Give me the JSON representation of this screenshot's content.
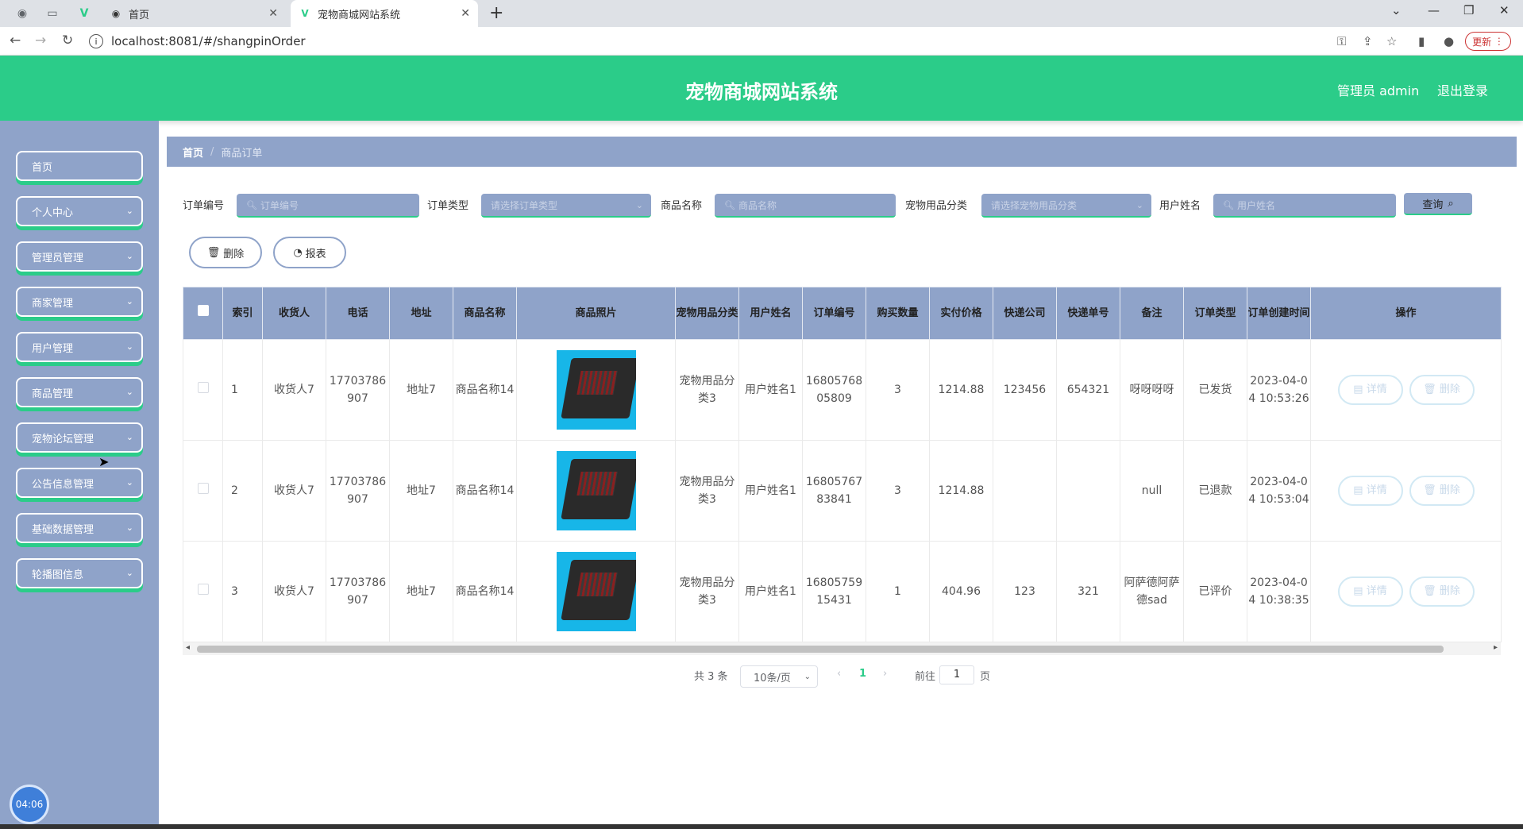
{
  "browser": {
    "tabs": [
      {
        "label": "首页",
        "active": false
      },
      {
        "label": "宠物商城网站系统",
        "active": true
      }
    ],
    "url": "localhost:8081/#/shangpinOrder",
    "update_label": "更新"
  },
  "header": {
    "title": "宠物商城网站系统",
    "admin": "管理员 admin",
    "logout": "退出登录"
  },
  "sidebar": {
    "items": [
      {
        "label": "首页"
      },
      {
        "label": "个人中心"
      },
      {
        "label": "管理员管理"
      },
      {
        "label": "商家管理"
      },
      {
        "label": "用户管理"
      },
      {
        "label": "商品管理"
      },
      {
        "label": "宠物论坛管理"
      },
      {
        "label": "公告信息管理"
      },
      {
        "label": "基础数据管理"
      },
      {
        "label": "轮播图信息"
      }
    ],
    "clock": "04:06"
  },
  "breadcrumb": {
    "home": "首页",
    "separator": "/",
    "current": "商品订单"
  },
  "search": {
    "fields": [
      {
        "label": "订单编号",
        "placeholder": "订单编号"
      },
      {
        "label": "订单类型",
        "placeholder": "请选择订单类型"
      },
      {
        "label": "商品名称",
        "placeholder": "商品名称"
      },
      {
        "label": "宠物用品分类",
        "placeholder": "请选择宠物用品分类"
      },
      {
        "label": "用户姓名",
        "placeholder": "用户姓名"
      }
    ],
    "query_label": "查询"
  },
  "actions": {
    "delete_label": "删除",
    "report_label": "报表"
  },
  "table": {
    "headers": [
      "索引",
      "收货人",
      "电话",
      "地址",
      "商品名称",
      "商品照片",
      "宠物用品分类",
      "用户姓名",
      "订单编号",
      "购买数量",
      "实付价格",
      "快递公司",
      "快递单号",
      "备注",
      "订单类型",
      "订单创建时间",
      "操作"
    ],
    "rows": [
      {
        "index": "1",
        "receiver": "收货人7",
        "phone": "17703786907",
        "address": "地址7",
        "product": "商品名称14",
        "category": "宠物用品分类3",
        "user": "用户姓名1",
        "order_no": "1680576805809",
        "qty": "3",
        "price": "1214.88",
        "courier": "123456",
        "tracking": "654321",
        "remark": "呀呀呀呀",
        "order_type": "已发货",
        "created": "2023-04-04 10:53:26"
      },
      {
        "index": "2",
        "receiver": "收货人7",
        "phone": "17703786907",
        "address": "地址7",
        "product": "商品名称14",
        "category": "宠物用品分类3",
        "user": "用户姓名1",
        "order_no": "1680576783841",
        "qty": "3",
        "price": "1214.88",
        "courier": "",
        "tracking": "",
        "remark": "null",
        "order_type": "已退款",
        "created": "2023-04-04 10:53:04"
      },
      {
        "index": "3",
        "receiver": "收货人7",
        "phone": "17703786907",
        "address": "地址7",
        "product": "商品名称14",
        "category": "宠物用品分类3",
        "user": "用户姓名1",
        "order_no": "1680575915431",
        "qty": "1",
        "price": "404.96",
        "courier": "123",
        "tracking": "321",
        "remark": "阿萨德阿萨德sad",
        "order_type": "已评价",
        "created": "2023-04-04 10:38:35"
      }
    ],
    "op_detail": "详情",
    "op_delete": "删除"
  },
  "pagination": {
    "total": "共 3 条",
    "page_size": "10条/页",
    "current_page": "1",
    "goto_prefix": "前往",
    "goto_value": "1",
    "goto_suffix": "页"
  },
  "colors": {
    "brand": "#2bcc89",
    "panel": "#8fa3c9"
  }
}
